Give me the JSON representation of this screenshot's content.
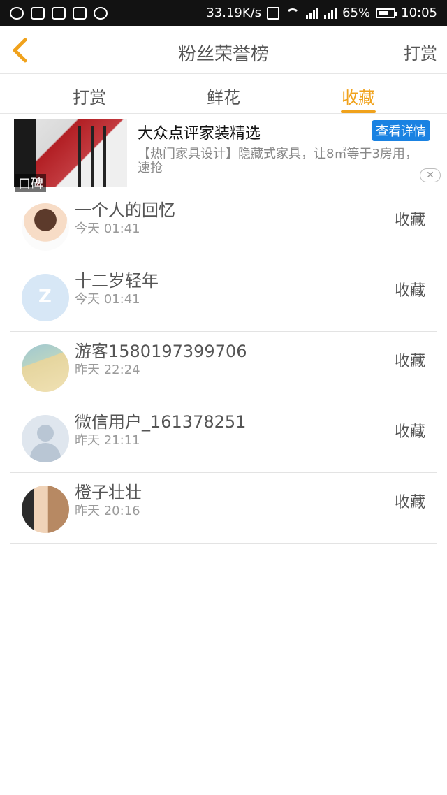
{
  "status_bar": {
    "speed": "33.19K/s",
    "battery_percent": "65%",
    "battery_level": 0.65,
    "time": "10:05"
  },
  "header": {
    "title": "粉丝荣誉榜",
    "right_action": "打赏"
  },
  "tabs": [
    {
      "label": "打赏",
      "active": false
    },
    {
      "label": "鲜花",
      "active": false
    },
    {
      "label": "收藏",
      "active": true
    }
  ],
  "ad": {
    "badge": "口碑",
    "title": "大众点评家装精选",
    "button": "查看详情",
    "desc": "【热门家具设计】隐藏式家具，让8㎡等于3房用，速抢",
    "close_symbol": "✕"
  },
  "list": [
    {
      "name": "一个人的回忆",
      "time": "今天 01:41",
      "action": "收藏",
      "avatar": "girl"
    },
    {
      "name": "十二岁轻年",
      "time": "今天 01:41",
      "action": "收藏",
      "avatar": "qq"
    },
    {
      "name": "游客1580197399706",
      "time": "昨天 22:24",
      "action": "收藏",
      "avatar": "beach"
    },
    {
      "name": "微信用户_161378251",
      "time": "昨天 21:11",
      "action": "收藏",
      "avatar": "user"
    },
    {
      "name": "橙子壮壮",
      "time": "昨天 20:16",
      "action": "收藏",
      "avatar": "anime"
    }
  ],
  "colors": {
    "accent": "#f0a21c",
    "blue_button": "#1a82e2"
  }
}
